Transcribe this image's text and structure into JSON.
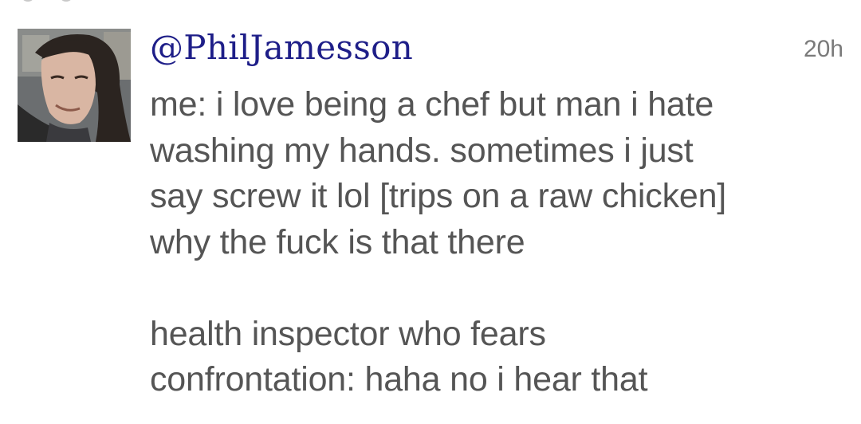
{
  "tweet": {
    "handle": "@PhilJamesson",
    "timestamp": "20h",
    "avatar_icon": "user-avatar-photo",
    "paragraph1": [
      "me: i love being a chef but man i hate",
      "washing my hands. sometimes i just",
      "say screw it lol [trips on a raw chicken]",
      "why the fuck is that there"
    ],
    "paragraph2": [
      "health inspector who fears",
      "confrontation: haha no i hear that"
    ]
  },
  "colors": {
    "handle": "#1e1e88",
    "text": "#555555",
    "timestamp": "#7a7a7a",
    "background": "#ffffff"
  }
}
